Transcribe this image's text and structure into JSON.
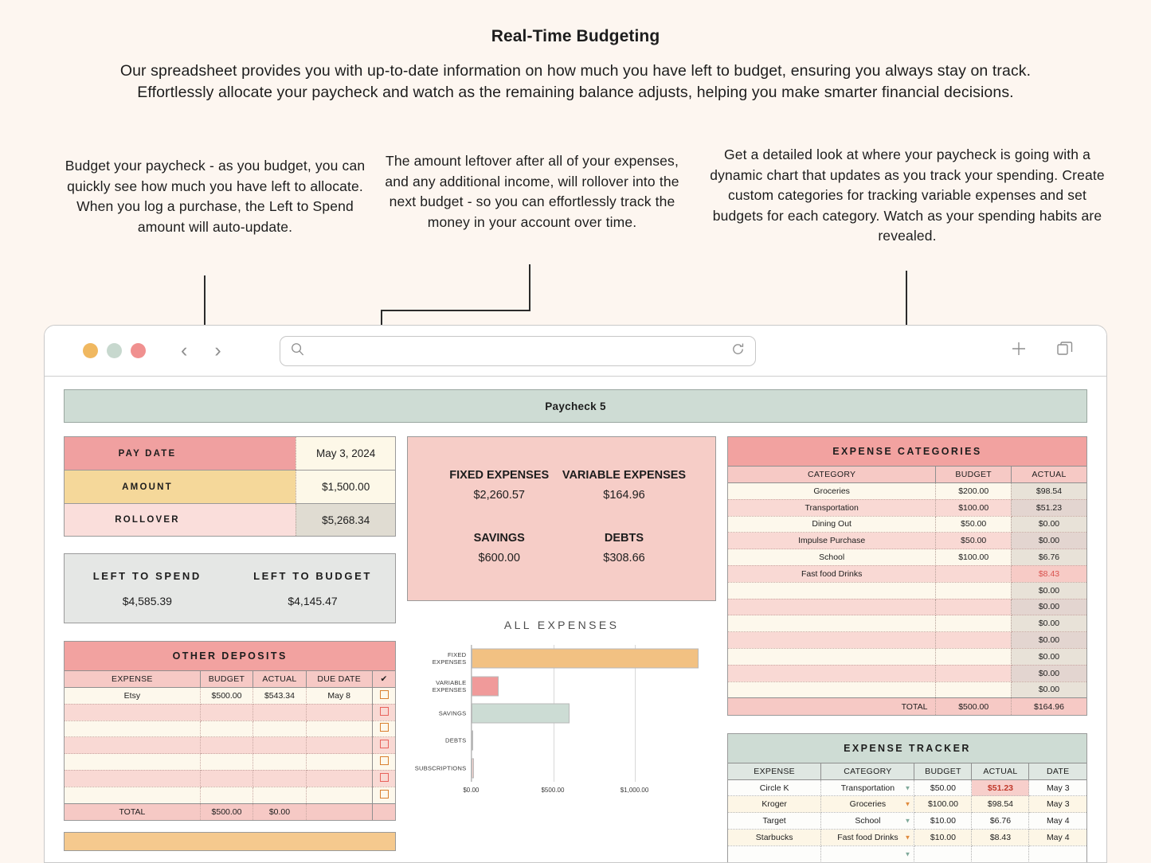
{
  "hero": {
    "title": "Real-Time Budgeting",
    "body": "Our spreadsheet provides you with up-to-date information on how much you have left to budget, ensuring you always stay on track. Effortlessly allocate your paycheck and watch as the remaining balance adjusts, helping you make smarter financial decisions."
  },
  "callouts": [
    {
      "text": "Budget your paycheck - as you budget, you can quickly see how much you have left to allocate. When you log a purchase, the Left to Spend amount will auto-update."
    },
    {
      "text": "The amount leftover after all of your expenses, and any additional income, will rollover into the next budget - so you can effortlessly track the money in your account over time."
    },
    {
      "text": "Get a detailed look at where your paycheck is going with a dynamic chart that updates as you track your spending. Create custom categories for tracking variable expenses and set budgets for each category. Watch as your spending habits are revealed."
    }
  ],
  "browser": {
    "lights": [
      {
        "name": "minimize-light",
        "color": "#f0b860"
      },
      {
        "name": "maximize-light",
        "color": "#c7d8ce"
      },
      {
        "name": "close-light",
        "color": "#f0908f"
      }
    ],
    "back_icon": "‹",
    "forward_icon": "›",
    "search_icon": "search-icon",
    "reload_icon": "reload-icon",
    "url_value": "",
    "url_placeholder": "",
    "new_tab_icon": "+",
    "tabs_icon": "tabs-icon"
  },
  "sheet": {
    "paycheck_title": "Paycheck 5",
    "summary": [
      {
        "label": "PAY DATE",
        "value": "May 3, 2024"
      },
      {
        "label": "AMOUNT",
        "value": "$1,500.00"
      },
      {
        "label": "ROLLOVER",
        "value": "$5,268.34"
      }
    ],
    "left_to": [
      {
        "label": "LEFT TO SPEND",
        "value": "$4,585.39"
      },
      {
        "label": "LEFT TO BUDGET",
        "value": "$4,145.47"
      }
    ],
    "other_deposits": {
      "title": "OTHER DEPOSITS",
      "headers": [
        "EXPENSE",
        "BUDGET",
        "ACTUAL",
        "DUE DATE",
        "✔"
      ],
      "rows": [
        {
          "expense": "Etsy",
          "budget": "$500.00",
          "actual": "$543.34",
          "due": "May 8",
          "check_color": "orange"
        },
        {
          "expense": "",
          "budget": "",
          "actual": "",
          "due": "",
          "check_color": "red"
        },
        {
          "expense": "",
          "budget": "",
          "actual": "",
          "due": "",
          "check_color": "orange"
        },
        {
          "expense": "",
          "budget": "",
          "actual": "",
          "due": "",
          "check_color": "red"
        },
        {
          "expense": "",
          "budget": "",
          "actual": "",
          "due": "",
          "check_color": "orange"
        },
        {
          "expense": "",
          "budget": "",
          "actual": "",
          "due": "",
          "check_color": "red"
        },
        {
          "expense": "",
          "budget": "",
          "actual": "",
          "due": "",
          "check_color": "orange"
        }
      ],
      "total": {
        "label": "TOTAL",
        "budget": "$500.00",
        "actual": "$0.00"
      }
    },
    "stats": [
      {
        "label": "FIXED EXPENSES",
        "value": "$2,260.57"
      },
      {
        "label": "VARIABLE EXPENSES",
        "value": "$164.96"
      },
      {
        "label": "SAVINGS",
        "value": "$600.00"
      },
      {
        "label": "DEBTS",
        "value": "$308.66"
      }
    ],
    "expense_categories": {
      "title": "EXPENSE CATEGORIES",
      "headers": [
        "CATEGORY",
        "BUDGET",
        "ACTUAL"
      ],
      "rows": [
        {
          "category": "Groceries",
          "budget": "$200.00",
          "actual": "$98.54",
          "highlight": false
        },
        {
          "category": "Transportation",
          "budget": "$100.00",
          "actual": "$51.23",
          "highlight": false
        },
        {
          "category": "Dining Out",
          "budget": "$50.00",
          "actual": "$0.00",
          "highlight": false
        },
        {
          "category": "Impulse Purchase",
          "budget": "$50.00",
          "actual": "$0.00",
          "highlight": false
        },
        {
          "category": "School",
          "budget": "$100.00",
          "actual": "$6.76",
          "highlight": false
        },
        {
          "category": "Fast food Drinks",
          "budget": "",
          "actual": "$8.43",
          "highlight": true
        },
        {
          "category": "",
          "budget": "",
          "actual": "$0.00",
          "highlight": false
        },
        {
          "category": "",
          "budget": "",
          "actual": "$0.00",
          "highlight": false
        },
        {
          "category": "",
          "budget": "",
          "actual": "$0.00",
          "highlight": false
        },
        {
          "category": "",
          "budget": "",
          "actual": "$0.00",
          "highlight": false
        },
        {
          "category": "",
          "budget": "",
          "actual": "$0.00",
          "highlight": false
        },
        {
          "category": "",
          "budget": "",
          "actual": "$0.00",
          "highlight": false
        },
        {
          "category": "",
          "budget": "",
          "actual": "$0.00",
          "highlight": false
        }
      ],
      "total": {
        "label": "TOTAL",
        "budget": "$500.00",
        "actual": "$164.96"
      }
    },
    "expense_tracker": {
      "title": "EXPENSE TRACKER",
      "headers": [
        "EXPENSE",
        "CATEGORY",
        "BUDGET",
        "ACTUAL",
        "DATE"
      ],
      "rows": [
        {
          "expense": "Circle K",
          "category": "Transportation",
          "budget": "$50.00",
          "actual": "$51.23",
          "date": "May 3",
          "over": true,
          "caret": "teal"
        },
        {
          "expense": "Kroger",
          "category": "Groceries",
          "budget": "$100.00",
          "actual": "$98.54",
          "date": "May 3",
          "over": false,
          "caret": "orange"
        },
        {
          "expense": "Target",
          "category": "School",
          "budget": "$10.00",
          "actual": "$6.76",
          "date": "May 4",
          "over": false,
          "caret": "teal"
        },
        {
          "expense": "Starbucks",
          "category": "Fast food Drinks",
          "budget": "$10.00",
          "actual": "$8.43",
          "date": "May 4",
          "over": false,
          "caret": "orange"
        },
        {
          "expense": "",
          "category": "",
          "budget": "",
          "actual": "",
          "date": "",
          "over": false,
          "caret": "teal"
        }
      ]
    }
  },
  "chart_data": {
    "type": "bar",
    "orientation": "horizontal",
    "title": "ALL EXPENSES",
    "categories": [
      "FIXED EXPENSES",
      "VARIABLE EXPENSES",
      "SAVINGS",
      "DEBTS",
      "SUBSCRIPTIONS"
    ],
    "values": [
      1390,
      165,
      600,
      0,
      15
    ],
    "colors": [
      "#f2c182",
      "#f09a9a",
      "#ccdcd4",
      "#f09a9a",
      "#f7d4d0"
    ],
    "xlabel": "",
    "ylabel": "",
    "xlim": [
      0,
      1450
    ],
    "ticks": [
      "$0.00",
      "$500.00",
      "$1,000.00"
    ],
    "tick_values": [
      0,
      500,
      1000
    ],
    "grid": true,
    "legend": false
  },
  "colors": {
    "page_bg": "#fdf6f0",
    "salmon": "#f0a0a0",
    "amber": "#f5d89a",
    "pale_pink": "#fadedb",
    "sage": "#cedcd4",
    "grey_panel": "#e5e7e5",
    "over_budget": "#c0392b"
  }
}
